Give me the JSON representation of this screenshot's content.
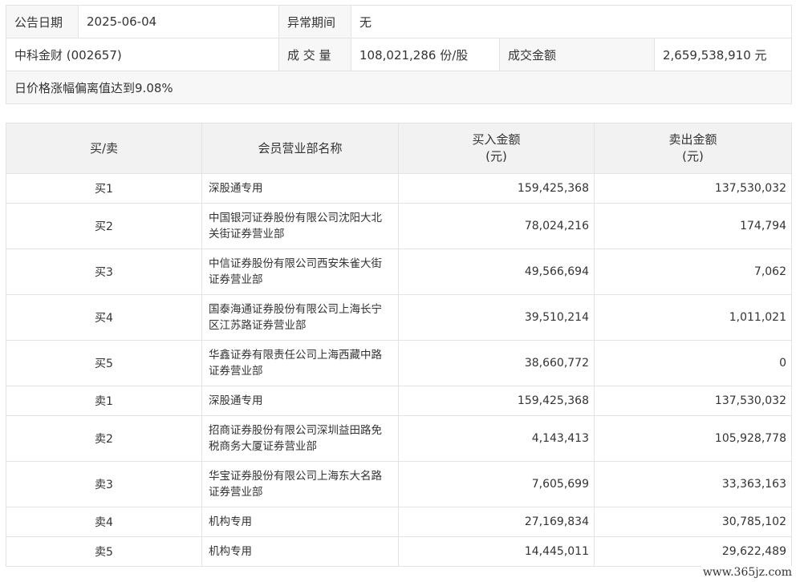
{
  "summary": {
    "date_label": "公告日期",
    "date_value": "2025-06-04",
    "period_label": "异常期间",
    "period_value": "无",
    "stock": "中科金财 (002657)",
    "volume_label": "成 交 量",
    "volume_value": "108,021,286 份/股",
    "amount_label": "成交金额",
    "amount_value": "2,659,538,910 元",
    "reason": "日价格涨幅偏离值达到9.08%"
  },
  "table": {
    "headers": {
      "side": "买/卖",
      "name": "会员营业部名称",
      "buy_line1": "买入金额",
      "buy_line2": "(元)",
      "sell_line1": "卖出金额",
      "sell_line2": "(元)"
    },
    "rows": [
      {
        "side": "买1",
        "name": "深股通专用",
        "buy": "159,425,368",
        "sell": "137,530,032"
      },
      {
        "side": "买2",
        "name": "中国银河证券股份有限公司沈阳大北关街证券营业部",
        "buy": "78,024,216",
        "sell": "174,794"
      },
      {
        "side": "买3",
        "name": "中信证券股份有限公司西安朱雀大街证券营业部",
        "buy": "49,566,694",
        "sell": "7,062"
      },
      {
        "side": "买4",
        "name": "国泰海通证券股份有限公司上海长宁区江苏路证券营业部",
        "buy": "39,510,214",
        "sell": "1,011,021"
      },
      {
        "side": "买5",
        "name": "华鑫证券有限责任公司上海西藏中路证券营业部",
        "buy": "38,660,772",
        "sell": "0"
      },
      {
        "side": "卖1",
        "name": "深股通专用",
        "buy": "159,425,368",
        "sell": "137,530,032"
      },
      {
        "side": "卖2",
        "name": "招商证券股份有限公司深圳益田路免税商务大厦证券营业部",
        "buy": "4,143,413",
        "sell": "105,928,778"
      },
      {
        "side": "卖3",
        "name": "华宝证券股份有限公司上海东大名路证券营业部",
        "buy": "7,605,699",
        "sell": "33,363,163"
      },
      {
        "side": "卖4",
        "name": "机构专用",
        "buy": "27,169,834",
        "sell": "30,785,102"
      },
      {
        "side": "卖5",
        "name": "机构专用",
        "buy": "14,445,011",
        "sell": "29,622,489"
      }
    ]
  },
  "watermark": "www.365jz.com"
}
